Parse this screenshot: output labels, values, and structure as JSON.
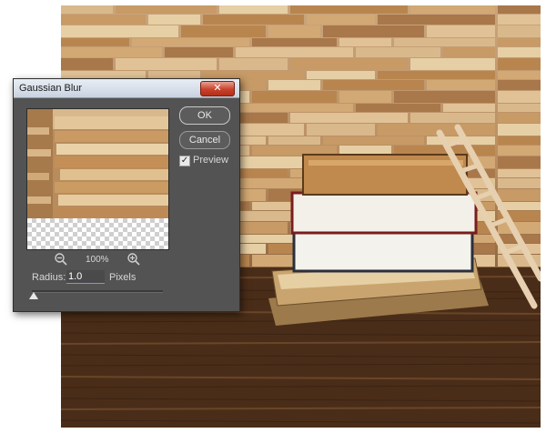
{
  "dialog": {
    "title": "Gaussian Blur",
    "close_glyph": "✕",
    "ok_label": "OK",
    "cancel_label": "Cancel",
    "preview_label": "Preview",
    "preview_checked": true,
    "check_glyph": "✓",
    "zoom_level": "100%",
    "radius_label": "Radius:",
    "radius_value": "1.0",
    "radius_unit": "Pixels"
  },
  "icons": {
    "zoom_out": "zoom-out-icon",
    "zoom_in": "zoom-in-icon"
  },
  "colors": {
    "dialog_bg": "#535353",
    "accent_selection": "#3d7bd9",
    "close_red": "#c8412b"
  }
}
